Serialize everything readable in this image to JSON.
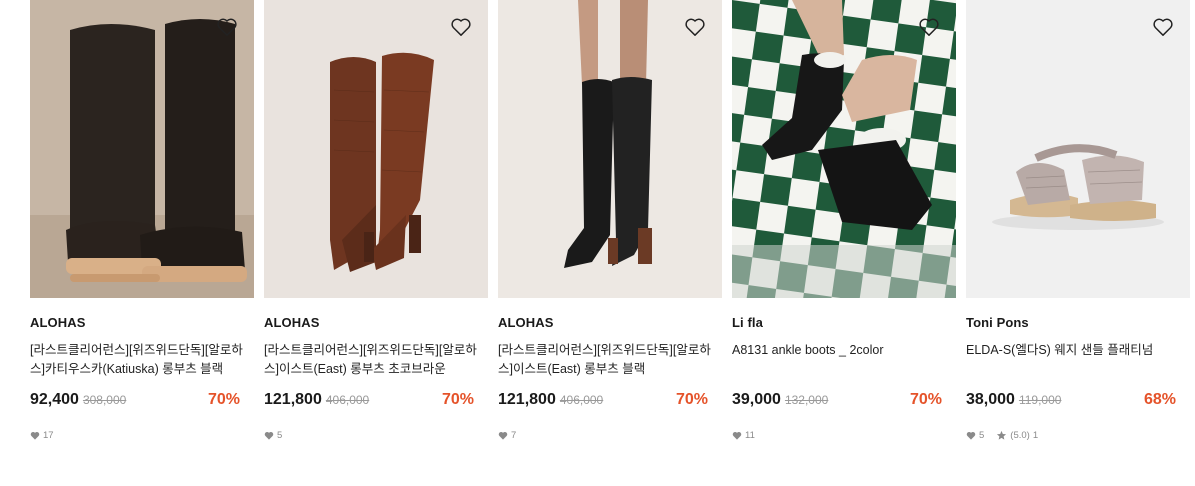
{
  "products": [
    {
      "brand": "ALOHAS",
      "name": "[라스트클리어런스][위즈위드단독][알로하스]카티우스카(Katiuska) 롱부츠 블랙",
      "price": "92,400",
      "original_price": "308,000",
      "discount": "70%",
      "likes": "17"
    },
    {
      "brand": "ALOHAS",
      "name": "[라스트클리어런스][위즈위드단독][알로하스]이스트(East) 롱부츠 초코브라운",
      "price": "121,800",
      "original_price": "406,000",
      "discount": "70%",
      "likes": "5"
    },
    {
      "brand": "ALOHAS",
      "name": "[라스트클리어런스][위즈위드단독][알로하스]이스트(East) 롱부츠 블랙",
      "price": "121,800",
      "original_price": "406,000",
      "discount": "70%",
      "likes": "7"
    },
    {
      "brand": "Li fla",
      "name": "A8131 ankle boots _ 2color",
      "price": "39,000",
      "original_price": "132,000",
      "discount": "70%",
      "likes": "11"
    },
    {
      "brand": "Toni Pons",
      "name": "ELDA-S(엘다S) 웨지 샌들 플래티넘",
      "price": "38,000",
      "original_price": "119,000",
      "discount": "68%",
      "likes": "5",
      "rating": "(5.0)",
      "review_count": "1"
    }
  ],
  "colors": {
    "discount": "#e5532a",
    "strike_price": "#9a9a9a",
    "text": "#1a1a1a",
    "meta": "#8a8a8a"
  },
  "icons": [
    "heart-outline-icon",
    "heart-filled-icon",
    "star-icon"
  ]
}
